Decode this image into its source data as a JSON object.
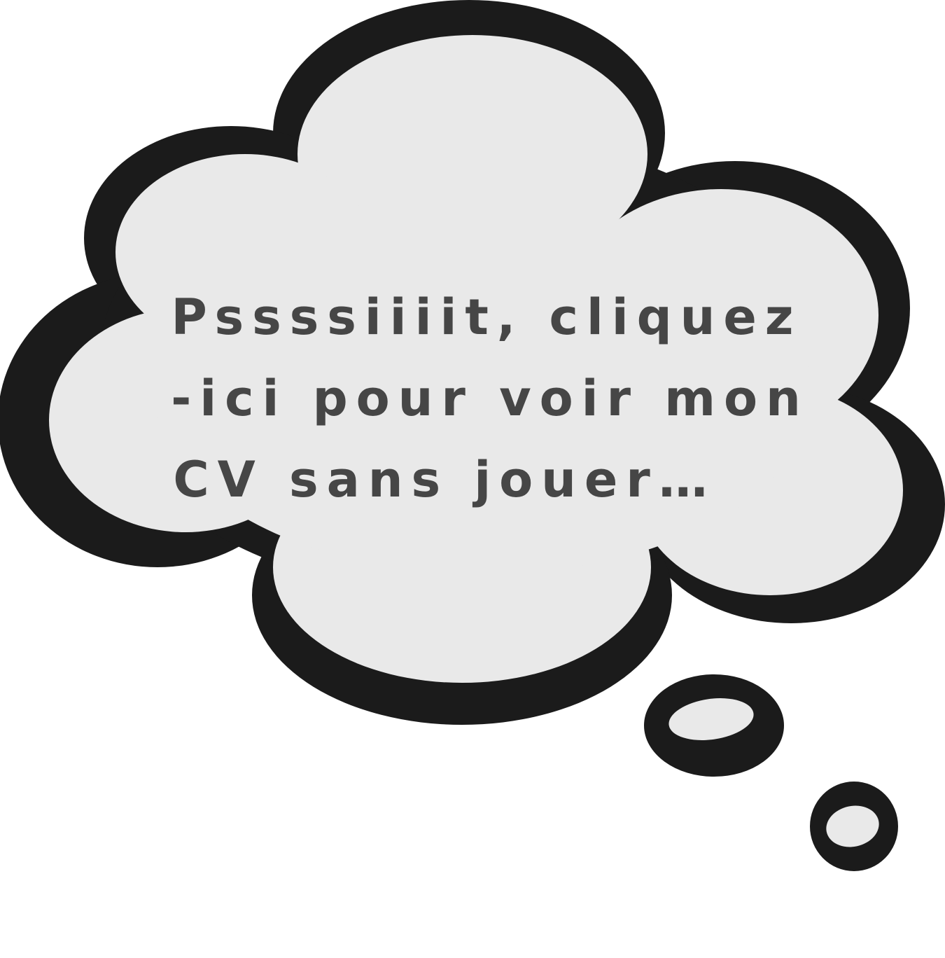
{
  "bubble": {
    "lines": [
      "Pssssiiiit, cliquez",
      "-ici pour voir mon",
      "CV sans jouer…"
    ],
    "colors": {
      "outline": "#1b1b1b",
      "fill": "#e9e9e9",
      "text": "#464646",
      "background": "#ffffff"
    }
  }
}
